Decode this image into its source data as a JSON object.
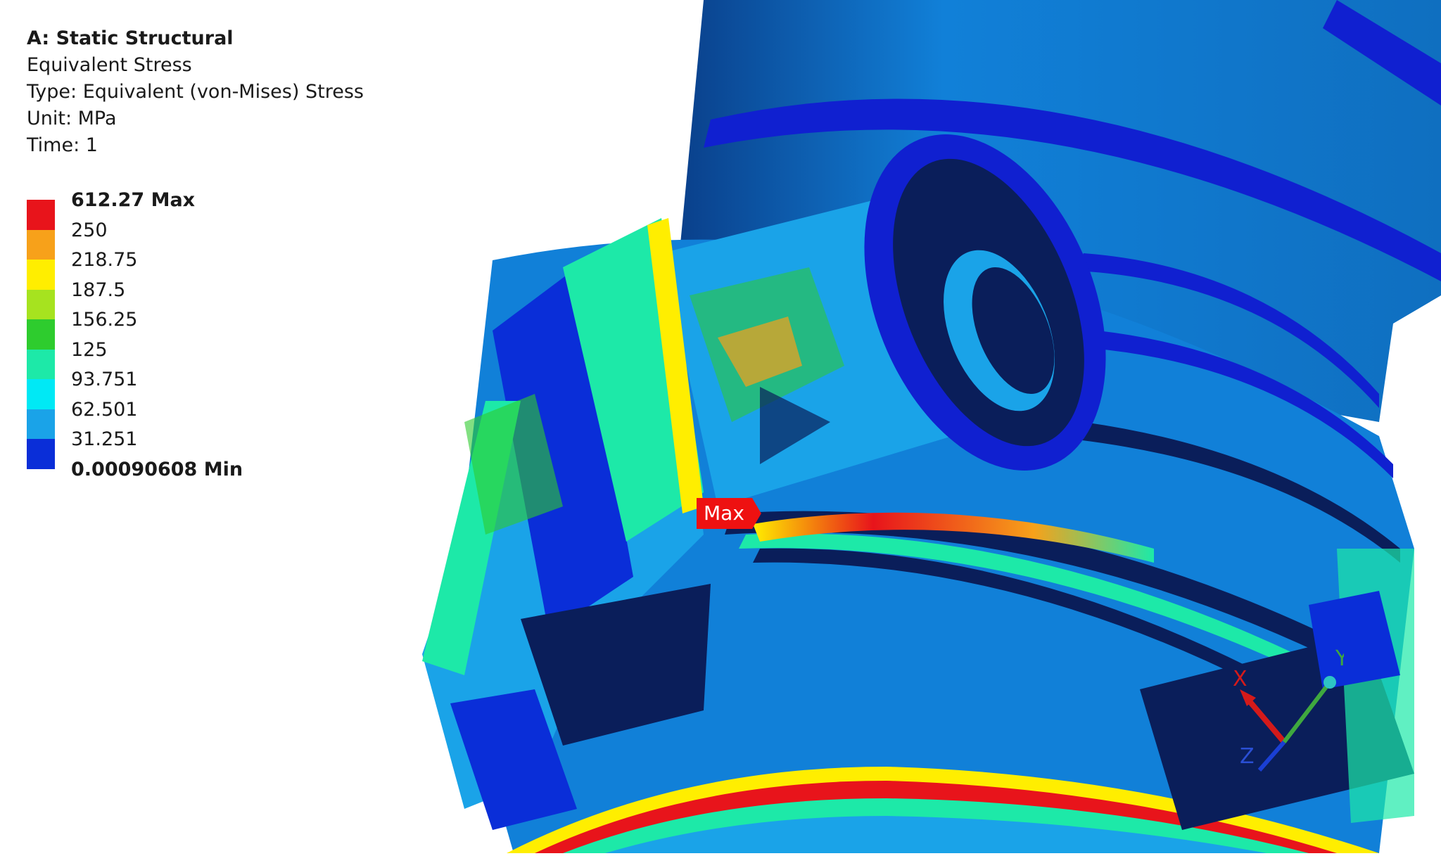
{
  "header": {
    "system": "A: Static Structural",
    "result": "Equivalent Stress",
    "type": "Type: Equivalent (von-Mises) Stress",
    "unit": "Unit: MPa",
    "time": "Time: 1"
  },
  "legend": {
    "max_label": "612.27 Max",
    "levels": [
      "250",
      "218.75",
      "187.5",
      "156.25",
      "125",
      "93.751",
      "62.501",
      "31.251"
    ],
    "min_label": "0.00090608 Min",
    "colors": [
      "#e8141b",
      "#f7a11a",
      "#ffee00",
      "#a6e31f",
      "#2ecc2e",
      "#1de9a8",
      "#00e9f5",
      "#1aa3e8",
      "#0a2ed8"
    ]
  },
  "probe": {
    "label": "Max"
  },
  "triad": {
    "x": "X",
    "y": "Y",
    "z": "Z"
  },
  "colors": {
    "body_base": "#1180d8",
    "dark_band": "#0a1e5a",
    "blue_band": "#1020d0"
  }
}
